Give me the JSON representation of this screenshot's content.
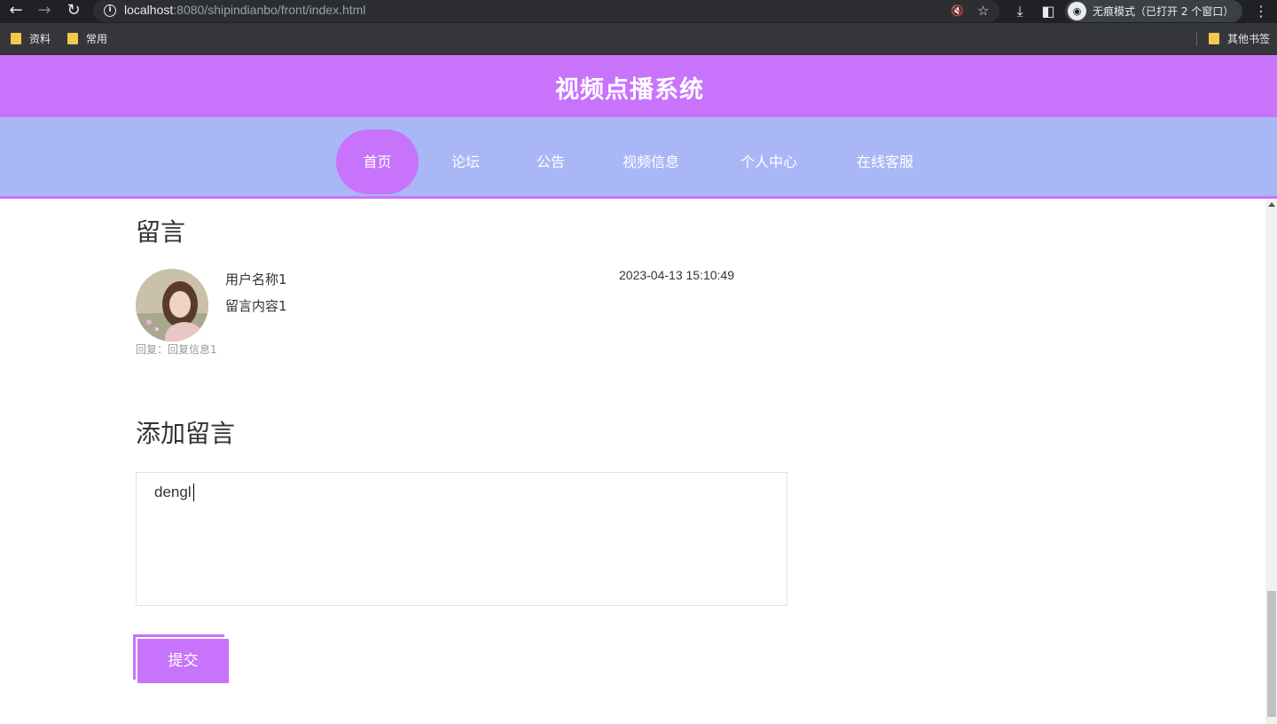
{
  "browser": {
    "url_host": "localhost",
    "url_rest": ":8080/shipindianbo/front/index.html",
    "incognito_label": "无痕模式（已打开 2 个窗口）",
    "bookmarks": [
      "资料",
      "常用"
    ],
    "other_bookmarks": "其他书签"
  },
  "site": {
    "title": "视频点播系统",
    "menu": [
      "首页",
      "论坛",
      "公告",
      "视频信息",
      "个人中心",
      "在线客服"
    ],
    "active_menu": "首页"
  },
  "messages": {
    "heading": "留言",
    "items": [
      {
        "username": "用户名称1",
        "content": "留言内容1",
        "time": "2023-04-13 15:10:49",
        "reply": "回复：回复信息1"
      }
    ]
  },
  "add_message": {
    "heading": "添加留言",
    "input_value": "dengl",
    "submit_label": "提交"
  },
  "colors": {
    "accent": "#c873fc",
    "menu_bg": "#a9b7f7"
  }
}
